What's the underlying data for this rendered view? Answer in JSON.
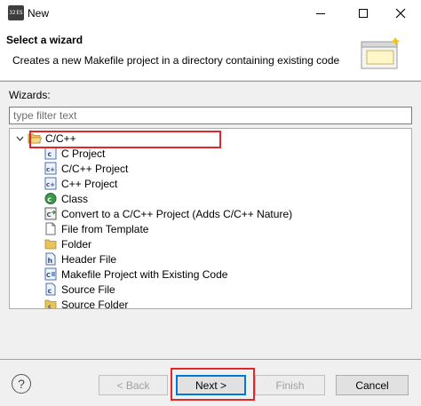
{
  "window": {
    "title": "New",
    "icon_text": [
      "32",
      "ES"
    ]
  },
  "header": {
    "title": "Select a wizard",
    "description": "Creates a new Makefile project in a directory containing existing code"
  },
  "wizards_label": "Wizards:",
  "filter": {
    "placeholder": "type filter text",
    "value": ""
  },
  "tree": {
    "group": {
      "label": "C/C++",
      "expanded": true
    },
    "items": [
      {
        "label": "C Project",
        "icon": "c-project-icon"
      },
      {
        "label": "C/C++ Project",
        "icon": "cpp-project-icon"
      },
      {
        "label": "C++ Project",
        "icon": "cpp-project-icon"
      },
      {
        "label": "Class",
        "icon": "class-icon"
      },
      {
        "label": "Convert to a C/C++ Project (Adds C/C++ Nature)",
        "icon": "convert-icon"
      },
      {
        "label": "File from Template",
        "icon": "file-icon"
      },
      {
        "label": "Folder",
        "icon": "folder-icon"
      },
      {
        "label": "Header File",
        "icon": "header-file-icon"
      },
      {
        "label": "Makefile Project with Existing Code",
        "icon": "makefile-project-icon",
        "selected": true
      },
      {
        "label": "Source File",
        "icon": "source-file-icon"
      },
      {
        "label": "Source Folder",
        "icon": "source-folder-icon"
      }
    ]
  },
  "buttons": {
    "help": "?",
    "back": "< Back",
    "next": "Next >",
    "finish": "Finish",
    "cancel": "Cancel"
  },
  "colors": {
    "highlight": "#e3262b",
    "default_button_border": "#0078d7",
    "folder": "#e8c35a"
  }
}
